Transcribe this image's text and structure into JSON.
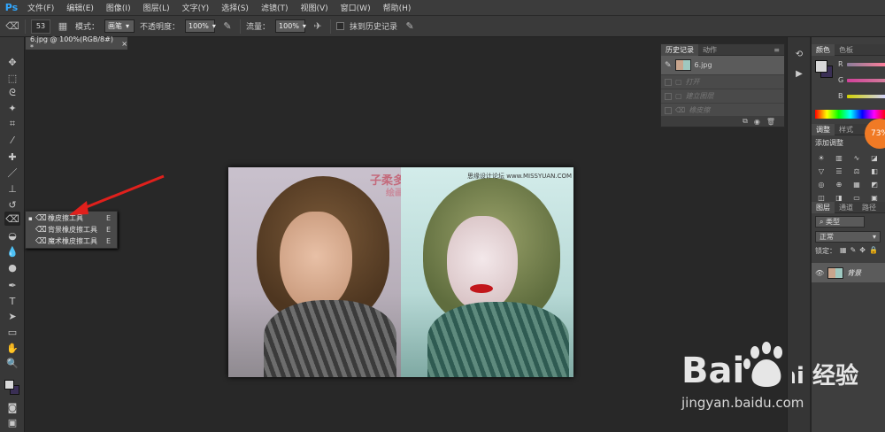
{
  "app": {
    "logo": "Ps"
  },
  "menubar": {
    "items": [
      "文件(F)",
      "编辑(E)",
      "图像(I)",
      "图层(L)",
      "文字(Y)",
      "选择(S)",
      "滤镜(T)",
      "视图(V)",
      "窗口(W)",
      "帮助(H)"
    ]
  },
  "options": {
    "brush_size": "53",
    "mode_label": "模式：",
    "mode_value": "画笔",
    "opacity_label": "不透明度：",
    "opacity_value": "100%",
    "flow_label": "流量：",
    "flow_value": "100%",
    "history_label": "抹到历史记录"
  },
  "document": {
    "tab_title": "6.jpg @ 100%(RGB/8#) *",
    "close": "×",
    "watermark_cn1": "子柔多地",
    "watermark_cn2": "绘画馆",
    "watermark_site": "思缘设计论坛 www.MISSYUAN.COM"
  },
  "flyout": {
    "items": [
      {
        "label": "橡皮擦工具",
        "key": "E",
        "selected": true
      },
      {
        "label": "背景橡皮擦工具",
        "key": "E",
        "selected": false
      },
      {
        "label": "魔术橡皮擦工具",
        "key": "E",
        "selected": false
      }
    ]
  },
  "history": {
    "tabs": [
      "历史记录",
      "动作"
    ],
    "snapshot": "6.jpg",
    "rows": [
      "打开",
      "建立图层",
      "橡皮擦"
    ]
  },
  "color_panel": {
    "tabs": [
      "颜色",
      "色板"
    ],
    "channels": [
      "R",
      "G",
      "B"
    ],
    "accent": "#4aa3df"
  },
  "adjust_panel": {
    "tabs": [
      "调整",
      "样式"
    ],
    "title": "添加调整",
    "badge": "73%"
  },
  "layers_panel": {
    "tabs": [
      "图层",
      "通道",
      "路径"
    ],
    "kind_label": "类型",
    "blend_mode": "正常",
    "lock_label": "锁定：",
    "layer_name": "背景"
  },
  "watermark": {
    "baidu": "Bai 经验",
    "site": "jingyan.baidu.com"
  }
}
